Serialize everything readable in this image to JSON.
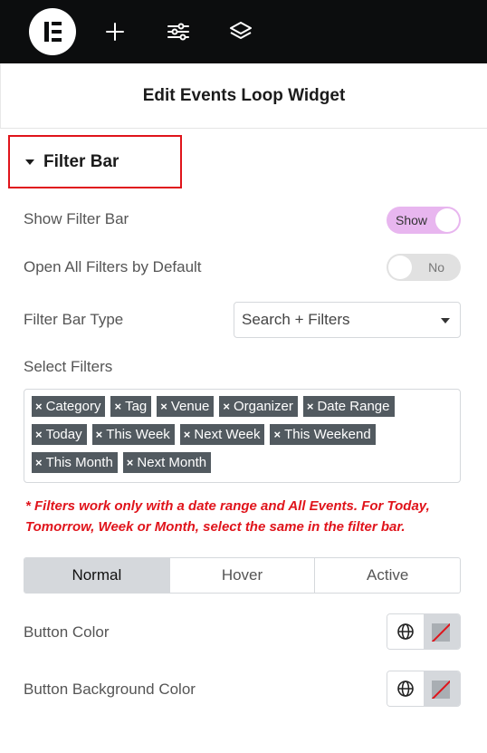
{
  "toolbar": {
    "logo_icon": "elementor-logo-icon",
    "add_icon": "plus-icon",
    "settings_icon": "sliders-icon",
    "navigator_icon": "layers-icon"
  },
  "panel": {
    "title": "Edit Events Loop Widget"
  },
  "section": {
    "title": "Filter Bar"
  },
  "controls": {
    "show_filter_bar": {
      "label": "Show Filter Bar",
      "state": "Show"
    },
    "open_all_filters": {
      "label": "Open All Filters by Default",
      "state": "No"
    },
    "filter_bar_type": {
      "label": "Filter Bar Type",
      "value": "Search + Filters"
    },
    "select_filters": {
      "label": "Select Filters",
      "remove_symbol": "×",
      "tags": [
        "Category",
        "Tag",
        "Venue",
        "Organizer",
        "Date Range",
        "Today",
        "This Week",
        "Next Week",
        "This Weekend",
        "This Month",
        "Next Month"
      ]
    },
    "note": "* Filters work only with a date range and All Events. For Today, Tomorrow, Week or Month, select the same in the filter bar.",
    "tabs": [
      "Normal",
      "Hover",
      "Active"
    ],
    "button_color": {
      "label": "Button Color"
    },
    "button_bg_color": {
      "label": "Button Background Color"
    }
  },
  "colors": {
    "accent_toggle": "#e8b6ef",
    "highlight": "#e0141b",
    "tag_bg": "#525a60",
    "topbar_bg": "#0c0d0e"
  }
}
